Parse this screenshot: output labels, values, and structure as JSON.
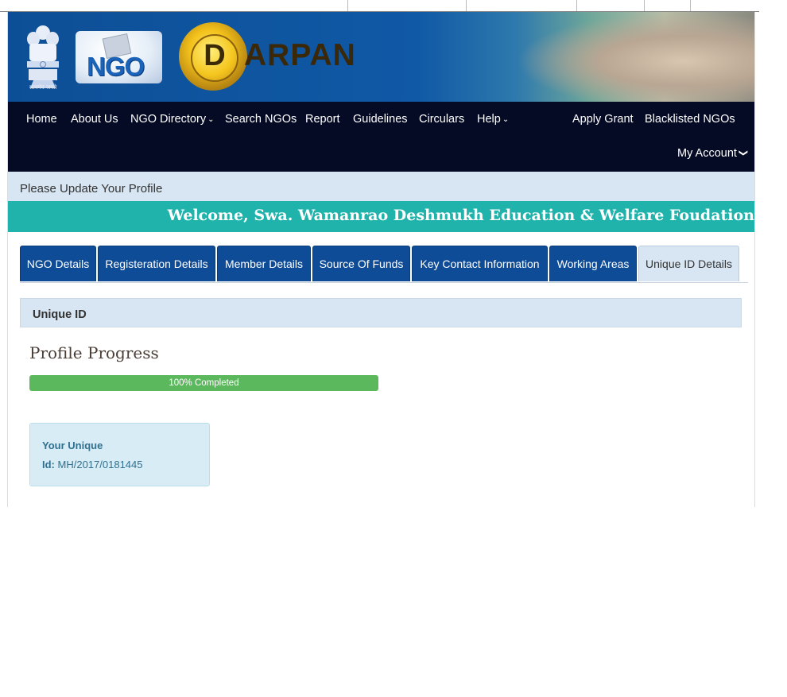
{
  "header": {
    "emblem_caption": "सत्यमेव जयते",
    "ngo_logo_text": "NGO",
    "darpan_letter": "D",
    "darpan_word": "ARPAN"
  },
  "nav": {
    "items": [
      {
        "label": "Home"
      },
      {
        "label": "About Us"
      },
      {
        "label": "NGO Directory"
      },
      {
        "label": "Search NGOs"
      },
      {
        "label": "Report"
      },
      {
        "label": "Guidelines"
      },
      {
        "label": "Circulars"
      },
      {
        "label": "Help"
      },
      {
        "label": "Apply Grant"
      },
      {
        "label": "Blacklisted NGOs"
      },
      {
        "label": "My Account"
      }
    ],
    "chevron_glyph": "⌄",
    "account_chevron_glyph": "❯"
  },
  "profile": {
    "update_notice": "Please Update Your Profile",
    "welcome": "Welcome, Swa. Wamanrao Deshmukh Education & Welfare Foudation"
  },
  "tabs": [
    {
      "label": "NGO Details"
    },
    {
      "label": "Registeration Details"
    },
    {
      "label": "Member Details"
    },
    {
      "label": "Source Of Funds"
    },
    {
      "label": "Key Contact Information"
    },
    {
      "label": "Working Areas"
    },
    {
      "label": "Unique ID Details"
    }
  ],
  "active_tab": "Unique ID Details",
  "section": {
    "title": "Unique ID",
    "progress_title": "Profile Progress",
    "progress_percent": 100,
    "progress_label": "100% Completed",
    "id_label_line1": "Your Unique",
    "id_label_line2": "Id:",
    "id_value": "MH/2017/0181445"
  },
  "colors": {
    "brand_blue": "#0f4c97",
    "nav_bg": "#050a25",
    "teal": "#1fb3ab",
    "progress_green": "#5cb85c",
    "info_text": "#31708f"
  }
}
